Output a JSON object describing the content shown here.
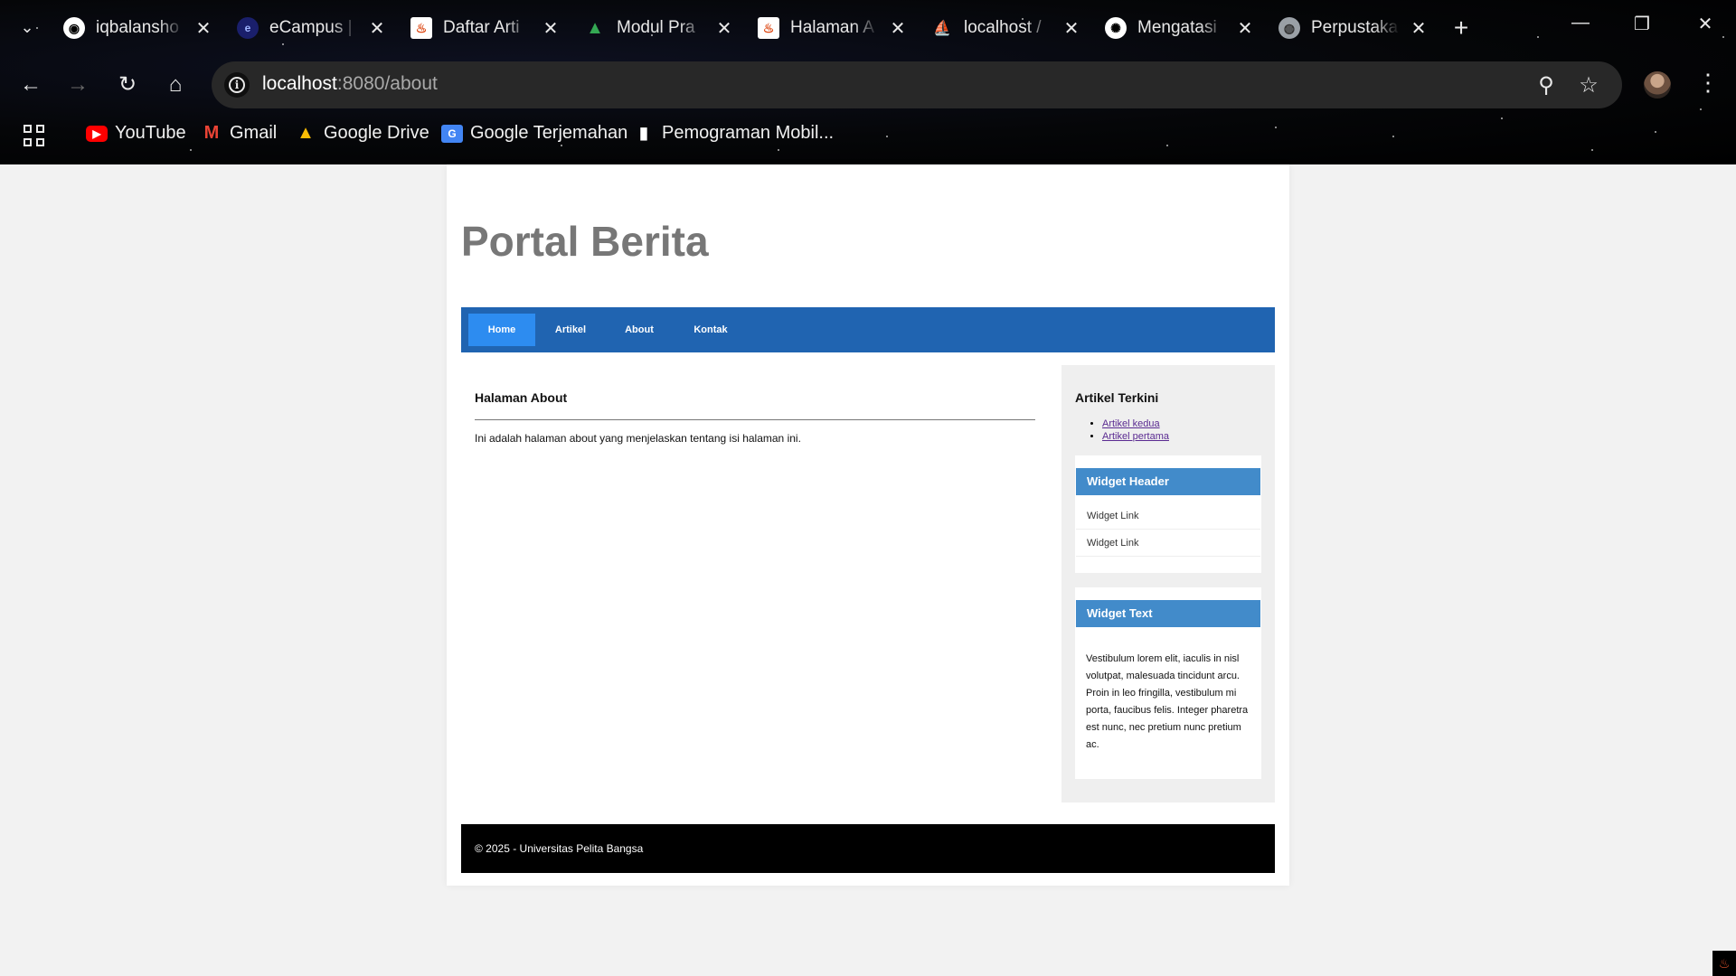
{
  "browser": {
    "tabs": [
      {
        "title": "iqbalansho",
        "favicon": "github-icon"
      },
      {
        "title": "eCampus |",
        "favicon": "ecampus-icon"
      },
      {
        "title": "Daftar Arti",
        "favicon": "codeigniter-icon"
      },
      {
        "title": "Modul Pra",
        "favicon": "google-drive-icon"
      },
      {
        "title": "Halaman A",
        "favicon": "codeigniter-icon"
      },
      {
        "title": "localhost /",
        "favicon": "phpmyadmin-icon"
      },
      {
        "title": "Mengatasi",
        "favicon": "chatgpt-icon"
      },
      {
        "title": "Perpustaka",
        "favicon": "globe-icon"
      }
    ],
    "url_host": "localhost",
    "url_rest": ":8080/about",
    "bookmarks": [
      {
        "label": "YouTube",
        "icon": "youtube-icon"
      },
      {
        "label": "Gmail",
        "icon": "gmail-icon"
      },
      {
        "label": "Google Drive",
        "icon": "google-drive-icon"
      },
      {
        "label": "Google Terjemahan",
        "icon": "google-translate-icon"
      },
      {
        "label": "Pemograman Mobil...",
        "icon": "bookmark-doc-icon"
      }
    ]
  },
  "site": {
    "title": "Portal Berita",
    "nav": [
      {
        "label": "Home",
        "active": true
      },
      {
        "label": "Artikel",
        "active": false
      },
      {
        "label": "About",
        "active": false
      },
      {
        "label": "Kontak",
        "active": false
      }
    ]
  },
  "content": {
    "heading": "Halaman About",
    "body": "Ini adalah halaman about yang menjelaskan tentang isi halaman ini."
  },
  "sidebar": {
    "recent_title": "Artikel Terkini",
    "recent_links": [
      "Artikel kedua",
      "Artikel pertama"
    ],
    "widget_header": {
      "title": "Widget Header",
      "links": [
        "Widget Link",
        "Widget Link"
      ]
    },
    "widget_text": {
      "title": "Widget Text",
      "body": "Vestibulum lorem elit, iaculis in nisl volutpat, malesuada tincidunt arcu. Proin in leo fringilla, vestibulum mi porta, faucibus felis. Integer pharetra est nunc, nec pretium nunc pretium ac."
    }
  },
  "footer": {
    "text": "© 2025 - Universitas Pelita Bangsa"
  },
  "colors": {
    "nav_bg": "#2064b1",
    "nav_active": "#2d8cf0",
    "widget_header": "#428bca",
    "footer_bg": "#000000",
    "title_gray": "#777777"
  }
}
